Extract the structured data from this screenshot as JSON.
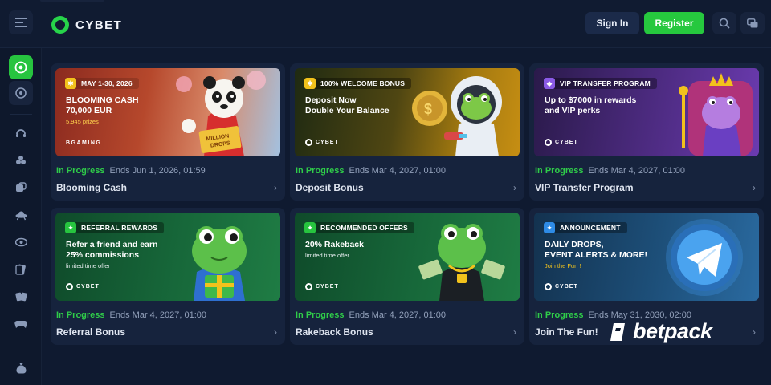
{
  "header": {
    "logo_text": "CYBET",
    "signin_label": "Sign In",
    "register_label": "Register",
    "icons": [
      "menu-icon",
      "search-icon",
      "chat-icon"
    ]
  },
  "sidebar": {
    "items": [
      "casino-icon",
      "sports-icon",
      "headset-icon",
      "cards-icon",
      "dice-icon",
      "ufo-icon",
      "eye-icon",
      "playing-cards-icon",
      "poker-cards-icon",
      "gamepad-icon",
      "money-bag-icon"
    ]
  },
  "colors": {
    "accent": "#27c43f",
    "background": "#0f1a30",
    "card": "#16233d",
    "status_green": "#2fcc49"
  },
  "promotions": [
    {
      "tag": "MAY 1-30, 2026",
      "headline": "BLOOMING CASH\n70,000 EUR",
      "sub": "5,945 prizes",
      "brand": "BGAMING",
      "status": "In Progress",
      "ends": "Ends Jun 1, 2026, 01:59",
      "title": "Blooming Cash"
    },
    {
      "tag": "100% WELCOME BONUS",
      "headline": "Deposit Now\nDouble Your Balance",
      "sub": "",
      "brand": "CYBET",
      "status": "In Progress",
      "ends": "Ends Mar 4, 2027, 01:00",
      "title": "Deposit Bonus"
    },
    {
      "tag": "VIP TRANSFER PROGRAM",
      "headline": "Up to $7000 in rewards\nand VIP perks",
      "sub": "",
      "brand": "CYBET",
      "status": "In Progress",
      "ends": "Ends Mar 4, 2027, 01:00",
      "title": "VIP Transfer Program"
    },
    {
      "tag": "REFERRAL REWARDS",
      "headline": "Refer a friend and earn\n25% commissions",
      "sub": "limited time offer",
      "brand": "CYBET",
      "status": "In Progress",
      "ends": "Ends Mar 4, 2027, 01:00",
      "title": "Referral Bonus"
    },
    {
      "tag": "RECOMMENDED OFFERS",
      "headline": "20% Rakeback",
      "sub": "limited time offer",
      "brand": "CYBET",
      "status": "In Progress",
      "ends": "Ends Mar 4, 2027, 01:00",
      "title": "Rakeback Bonus"
    },
    {
      "tag": "ANNOUNCEMENT",
      "headline": "DAILY DROPS,\nEVENT ALERTS & MORE!",
      "sub": "Join the Fun !",
      "brand": "CYBET",
      "status": "In Progress",
      "ends": "Ends May 31, 2030, 02:00",
      "title": "Join The Fun!"
    }
  ],
  "watermark": "betpack"
}
